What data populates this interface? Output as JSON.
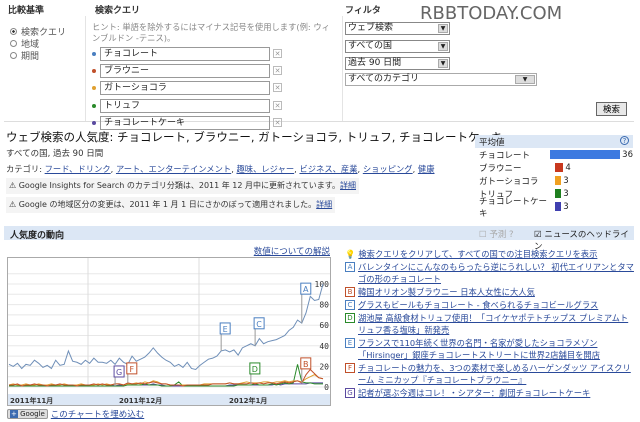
{
  "header": {
    "compare_label": "比較基準",
    "query_label": "検索クエリ",
    "filter_label": "フィルタ",
    "watermark": "RBBTODAY.COM"
  },
  "compare": [
    {
      "label": "検索クエリ",
      "checked": true
    },
    {
      "label": "地域",
      "checked": false
    },
    {
      "label": "期間",
      "checked": false
    }
  ],
  "hint": "ヒント: 単語を除外するにはマイナス記号を使用します(例: ウィンブルドン -テニス)。",
  "queries": [
    {
      "value": "チョコレート",
      "color": "#4a7fc0"
    },
    {
      "value": "ブラウニー",
      "color": "#c0502a"
    },
    {
      "value": "ガトーショコラ",
      "color": "#e0a030"
    },
    {
      "value": "トリュフ",
      "color": "#2a8a2a"
    },
    {
      "value": "チョコレートケーキ",
      "color": "#5a4aa0"
    }
  ],
  "filters": {
    "search_type": "ウェブ検索",
    "country": "すべての国",
    "period": "過去 90 日間",
    "category": "すべてのカテゴリ"
  },
  "search_button": "検索",
  "result": {
    "title": "ウェブ検索の人気度: チョコレート, ブラウニー, ガトーショコラ, トリュフ, チョコレートケーキ",
    "subtitle": "すべての国, 過去 90 日間",
    "category_prefix": "カテゴリ:",
    "categories": [
      "フード、ドリンク",
      "アート、エンターテインメント",
      "趣味、レジャー",
      "ビジネス、産業",
      "ショッピング",
      "健康"
    ],
    "notes": [
      {
        "text": "Google Insights for Search のカテゴリ分類は、2011 年 12 月中に更新されています。",
        "link": "詳細"
      },
      {
        "text": "Google の地域区分の変更は、2011 年 1 月 1 日にさかのぼって適用されました。",
        "link": "詳細"
      }
    ]
  },
  "averages": {
    "title": "平均値",
    "help": "?",
    "rows": [
      {
        "name": "チョコレート",
        "value": 36,
        "color": "#3d7ae0"
      },
      {
        "name": "ブラウニー",
        "value": 4,
        "color": "#c8381e"
      },
      {
        "name": "ガトーショコラ",
        "value": 3,
        "color": "#f0a020"
      },
      {
        "name": "トリュフ",
        "value": 3,
        "color": "#1f7f1f"
      },
      {
        "name": "チョコレートケーキ",
        "value": 3,
        "color": "#4040b0"
      }
    ]
  },
  "trend": {
    "title": "人気度の動向",
    "forecast": "予測",
    "forecast_help": "?",
    "news_headlines": "ニュースのヘッドライン",
    "explain_link": "数値についての解説",
    "embed": "このチャートを埋め込む",
    "google": "Google"
  },
  "news": {
    "clear": "検索クエリをクリアして、すべての国での注目検索クエリを表示",
    "items": [
      {
        "key": "A",
        "text": "バレンタインにこんなのもらったら逆にうれしい？ 初代エイリアンとタマゴの形のチョコレート",
        "color": "#4a7fc0"
      },
      {
        "key": "B",
        "text": "韓国オリオン製ブラウニー 日本人女性に大人気",
        "color": "#c0502a"
      },
      {
        "key": "C",
        "text": "グラスもビールもチョコレート - 食べられるチョコビールグラス",
        "color": "#4a7fc0"
      },
      {
        "key": "D",
        "text": "湖池屋 高級食材トリュフ使用！「コイケヤポテトチップス プレミアムトリュフ香る塩味」新発売",
        "color": "#2a8a2a"
      },
      {
        "key": "E",
        "text": "フランスで110年続く世界の名門・名家が愛したショコラメゾン「Hirsinger」銀座チョコレートストリートに世界2店舗目を開店",
        "color": "#4a7fc0"
      },
      {
        "key": "F",
        "text": "チョコレートの魅力を、3つの素材で楽しめるハーゲンダッツ アイスクリーム ミニカップ『チョコレートブラウニー』",
        "color": "#c0502a"
      },
      {
        "key": "G",
        "text": "記者が選ぶ今週はコレ！・シアター：劇団チョコレートケーキ",
        "color": "#5a4aa0"
      }
    ]
  },
  "chart_data": {
    "type": "line",
    "ylim": [
      0,
      100
    ],
    "yticks": [
      "100",
      "80",
      "60",
      "40",
      "20",
      "0"
    ],
    "xticks": [
      "2011年11月",
      "2011年12月",
      "2012年1月"
    ],
    "series": [
      {
        "name": "チョコレート",
        "color": "#6f8fb8",
        "values": [
          22,
          20,
          23,
          18,
          22,
          21,
          26,
          23,
          19,
          21,
          18,
          26,
          21,
          22,
          35,
          25,
          24,
          22,
          26,
          23,
          28,
          24,
          24,
          23,
          26,
          22,
          28,
          24,
          22,
          30,
          25,
          27,
          29,
          33,
          38,
          33,
          29,
          26,
          24,
          20,
          22,
          19,
          24,
          18,
          17,
          21,
          24,
          27,
          28,
          30,
          35,
          36,
          34,
          36,
          31,
          38,
          40,
          42,
          40,
          47,
          42,
          44,
          45,
          46,
          48,
          50,
          55,
          58,
          65,
          62,
          72,
          88,
          84,
          85,
          100
        ]
      },
      {
        "name": "ブラウニー",
        "color": "#c0502a",
        "values": [
          2,
          2,
          3,
          1,
          2,
          2,
          3,
          2,
          2,
          1,
          2,
          2,
          3,
          2,
          2,
          2,
          1,
          2,
          2,
          2,
          3,
          2,
          3,
          2,
          2,
          3,
          3,
          2,
          4,
          3,
          3,
          4,
          3,
          4,
          5,
          4,
          3,
          3,
          2,
          2,
          2,
          1,
          2,
          2,
          2,
          2,
          2,
          2,
          3,
          3,
          3,
          3,
          4,
          3,
          3,
          3,
          3,
          4,
          3,
          4,
          3,
          4,
          4,
          3,
          4,
          5,
          4,
          5,
          6,
          4,
          12,
          17,
          13,
          9,
          8
        ]
      },
      {
        "name": "ガトーショコラ",
        "color": "#e0a030",
        "values": [
          2,
          3,
          2,
          2,
          3,
          2,
          2,
          3,
          2,
          2,
          3,
          2,
          2,
          3,
          2,
          2,
          2,
          3,
          2,
          2,
          2,
          3,
          2,
          3,
          2,
          3,
          3,
          2,
          3,
          3,
          4,
          3,
          5,
          4,
          6,
          5,
          3,
          3,
          2,
          2,
          2,
          2,
          2,
          2,
          2,
          2,
          3,
          3,
          3,
          3,
          3,
          3,
          4,
          3,
          3,
          4,
          5,
          4,
          4,
          4,
          5,
          5,
          4,
          5,
          5,
          6,
          5,
          6,
          6,
          5,
          8,
          10,
          12,
          9,
          8
        ]
      },
      {
        "name": "トリュフ",
        "color": "#2a8a2a",
        "values": [
          1,
          1,
          1,
          1,
          1,
          1,
          1,
          1,
          1,
          1,
          1,
          1,
          1,
          1,
          1,
          1,
          1,
          1,
          1,
          1,
          1,
          1,
          1,
          1,
          1,
          1,
          1,
          1,
          2,
          2,
          2,
          2,
          3,
          2,
          2,
          2,
          1,
          1,
          1,
          2,
          5,
          1,
          1,
          1,
          1,
          1,
          1,
          1,
          1,
          1,
          1,
          1,
          1,
          1,
          2,
          2,
          2,
          2,
          3,
          2,
          2,
          2,
          3,
          2,
          3,
          4,
          3,
          4,
          22,
          5,
          4,
          4,
          3,
          3,
          3
        ]
      },
      {
        "name": "チョコレートケーキ",
        "color": "#5a4aa0",
        "values": [
          1,
          1,
          1,
          1,
          1,
          1,
          1,
          1,
          1,
          1,
          1,
          1,
          1,
          1,
          1,
          1,
          1,
          1,
          1,
          1,
          1,
          1,
          1,
          1,
          2,
          1,
          2,
          2,
          2,
          2,
          2,
          2,
          2,
          2,
          3,
          2,
          2,
          1,
          1,
          1,
          1,
          1,
          1,
          1,
          1,
          1,
          1,
          1,
          1,
          1,
          1,
          1,
          2,
          2,
          2,
          2,
          2,
          2,
          2,
          2,
          2,
          2,
          2,
          3,
          2,
          3,
          3,
          3,
          3,
          3,
          3,
          4,
          4,
          4,
          4
        ]
      }
    ],
    "annotations": [
      {
        "key": "G",
        "index": 25
      },
      {
        "key": "F",
        "index": 28
      },
      {
        "key": "E",
        "index": 50
      },
      {
        "key": "C",
        "index": 58
      },
      {
        "key": "D",
        "index": 57
      },
      {
        "key": "A",
        "index": 69
      },
      {
        "key": "B",
        "index": 69
      }
    ]
  }
}
